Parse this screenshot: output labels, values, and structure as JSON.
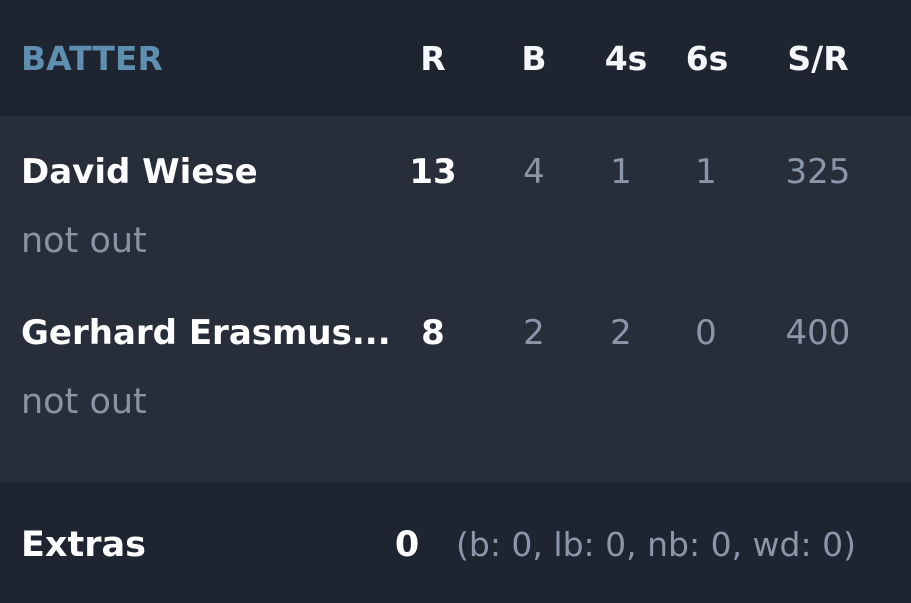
{
  "header": {
    "batter_label": "BATTER",
    "columns": [
      "R",
      "B",
      "4s",
      "6s",
      "S/R"
    ]
  },
  "batters": [
    {
      "name": "David Wiese",
      "status": "not out",
      "runs": "13",
      "balls": "4",
      "fours": "1",
      "sixes": "1",
      "strike_rate": "325"
    },
    {
      "name": "Gerhard Erasmus...",
      "status": "not out",
      "runs": "8",
      "balls": "2",
      "fours": "2",
      "sixes": "0",
      "strike_rate": "400"
    }
  ],
  "extras": {
    "label": "Extras",
    "total": "0",
    "detail": "(b: 0, lb: 0, nb: 0, wd: 0)"
  },
  "colors": {
    "header_label": "#5f8fb0",
    "background": "#1f2530",
    "row_background": "#272e3a"
  }
}
